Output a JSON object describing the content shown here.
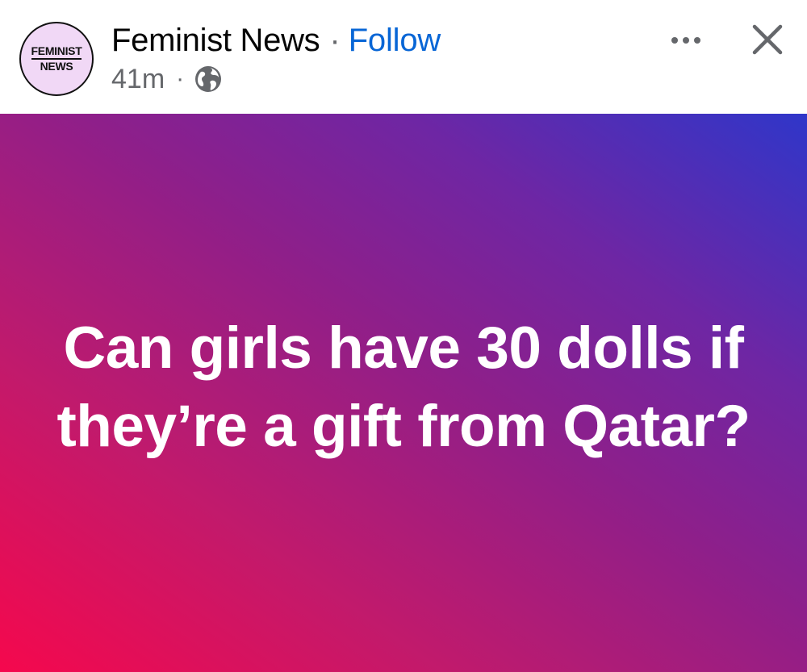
{
  "header": {
    "avatar_line1": "FEMINIST",
    "avatar_line2": "NEWS",
    "page_name": "Feminist News",
    "separator": "·",
    "follow_label": "Follow",
    "time": "41m",
    "meta_separator": "·",
    "audience_icon": "globe-icon",
    "more_icon": "more-options-icon",
    "close_icon": "close-icon"
  },
  "post": {
    "text": "Can girls have 30 dolls if they’re a gift from Qatar?"
  },
  "colors": {
    "follow": "#0866d6",
    "secondary_text": "#65676b",
    "avatar_bg": "#f1d8f6",
    "gradient_start": "#f5084d",
    "gradient_end": "#2f36c9"
  }
}
